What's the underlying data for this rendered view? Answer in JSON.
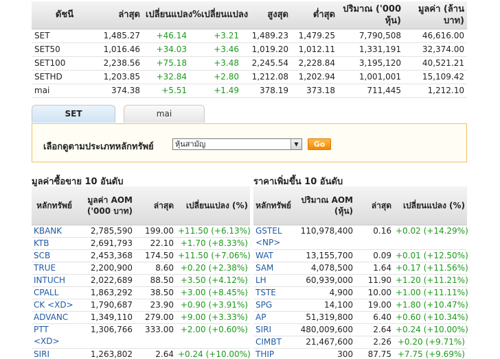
{
  "index_table": {
    "headers": [
      "ดัชนี",
      "ล่าสุด",
      "เปลี่ยนแปลง",
      "%เปลี่ยนแปลง",
      "สูงสุด",
      "ต่ำสุด",
      "ปริมาณ ('000 หุ้น)",
      "มูลค่า (ล้านบาท)"
    ],
    "rows": [
      [
        "SET",
        "1,485.27",
        "+46.14",
        "+3.21",
        "1,489.23",
        "1,479.25",
        "7,790,508",
        "46,616.00"
      ],
      [
        "SET50",
        "1,016.46",
        "+34.03",
        "+3.46",
        "1,019.20",
        "1,012.11",
        "1,331,191",
        "32,374.00"
      ],
      [
        "SET100",
        "2,238.56",
        "+75.18",
        "+3.48",
        "2,245.54",
        "2,228.84",
        "3,195,120",
        "40,521.21"
      ],
      [
        "SETHD",
        "1,203.85",
        "+32.84",
        "+2.80",
        "1,212.08",
        "1,202.94",
        "1,001,001",
        "15,109.42"
      ],
      [
        "mai",
        "374.38",
        "+5.51",
        "+1.49",
        "378.19",
        "373.18",
        "711,445",
        "1,212.10"
      ]
    ]
  },
  "tabs": [
    "SET",
    "mai"
  ],
  "filter": {
    "label": "เลือกดูตามประเภทหลักทรัพย์",
    "selected": "หุ้นสามัญ",
    "go_label": "Go"
  },
  "top_value": {
    "title": "มูลค่าซื้อขาย 10 อันดับ",
    "headers": [
      "หลักทรัพย์",
      "มูลค่า AOM ('000 บาท)",
      "ล่าสุด",
      "เปลี่ยนแปลง (%)"
    ],
    "rows": [
      {
        "symbol": "KBANK",
        "sub": "",
        "value": "2,785,590",
        "last": "199.00",
        "change": "+11.50 (+6.13%)"
      },
      {
        "symbol": "KTB",
        "sub": "",
        "value": "2,691,793",
        "last": "22.10",
        "change": "+1.70 (+8.33%)"
      },
      {
        "symbol": "SCB",
        "sub": "",
        "value": "2,453,368",
        "last": "174.50",
        "change": "+11.50 (+7.06%)"
      },
      {
        "symbol": "TRUE",
        "sub": "",
        "value": "2,200,900",
        "last": "8.60",
        "change": "+0.20 (+2.38%)"
      },
      {
        "symbol": "INTUCH",
        "sub": "",
        "value": "2,022,689",
        "last": "88.50",
        "change": "+3.50 (+4.12%)"
      },
      {
        "symbol": "CPALL",
        "sub": "",
        "value": "1,863,292",
        "last": "38.50",
        "change": "+3.00 (+8.45%)"
      },
      {
        "symbol": "CK <XD>",
        "sub": "",
        "value": "1,790,687",
        "last": "23.90",
        "change": "+0.90 (+3.91%)"
      },
      {
        "symbol": "ADVANC",
        "sub": "",
        "value": "1,349,110",
        "last": "279.00",
        "change": "+9.00 (+3.33%)"
      },
      {
        "symbol": "PTT",
        "sub": "<XD>",
        "value": "1,306,766",
        "last": "333.00",
        "change": "+2.00 (+0.60%)"
      },
      {
        "symbol": "SIRI",
        "sub": "",
        "value": "1,263,802",
        "last": "2.64",
        "change": "+0.24 (+10.00%)"
      }
    ]
  },
  "top_gainers": {
    "title": "ราคาเพิ่มขึ้น 10 อันดับ",
    "headers": [
      "หลักทรัพย์",
      "ปริมาณ AOM (หุ้น)",
      "ล่าสุด",
      "เปลี่ยนแปลง (%)"
    ],
    "rows": [
      {
        "symbol": "GSTEL",
        "sub": "<NP>",
        "volume": "110,978,400",
        "last": "0.16",
        "change": "+0.02 (+14.29%)"
      },
      {
        "symbol": "WAT",
        "sub": "",
        "volume": "13,155,700",
        "last": "0.09",
        "change": "+0.01 (+12.50%)"
      },
      {
        "symbol": "SAM",
        "sub": "",
        "volume": "4,078,500",
        "last": "1.64",
        "change": "+0.17 (+11.56%)"
      },
      {
        "symbol": "LH",
        "sub": "",
        "volume": "60,939,000",
        "last": "11.90",
        "change": "+1.20 (+11.21%)"
      },
      {
        "symbol": "TSTE",
        "sub": "",
        "volume": "4,900",
        "last": "10.00",
        "change": "+1.00 (+11.11%)"
      },
      {
        "symbol": "SPG",
        "sub": "",
        "volume": "14,100",
        "last": "19.00",
        "change": "+1.80 (+10.47%)"
      },
      {
        "symbol": "AP",
        "sub": "",
        "volume": "51,319,800",
        "last": "6.40",
        "change": "+0.60 (+10.34%)"
      },
      {
        "symbol": "SIRI",
        "sub": "",
        "volume": "480,009,600",
        "last": "2.64",
        "change": "+0.24 (+10.00%)"
      },
      {
        "symbol": "CIMBT",
        "sub": "",
        "volume": "21,467,600",
        "last": "2.26",
        "change": "+0.20 (+9.71%)"
      },
      {
        "symbol": "THIP",
        "sub": "",
        "volume": "300",
        "last": "87.75",
        "change": "+7.75 (+9.69%)"
      }
    ]
  }
}
